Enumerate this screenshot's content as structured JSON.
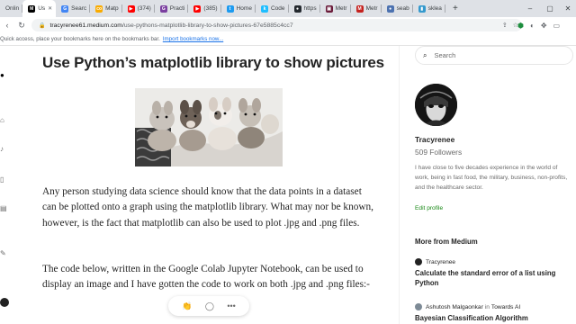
{
  "browser": {
    "tabs": [
      {
        "label": "Onlin",
        "color": "#ffffff",
        "glyph": "",
        "active": false
      },
      {
        "label": "Us",
        "color": "#000000",
        "glyph": "M",
        "active": true
      },
      {
        "label": "Searc",
        "color": "#4285f4",
        "glyph": "G",
        "active": false
      },
      {
        "label": "Matp",
        "color": "#f9ab00",
        "glyph": "co",
        "active": false
      },
      {
        "label": "(374)",
        "color": "#ff0000",
        "glyph": "▶",
        "active": false
      },
      {
        "label": "Practi",
        "color": "#7b3fa0",
        "glyph": "G",
        "active": false
      },
      {
        "label": "(385)",
        "color": "#ff0000",
        "glyph": "▶",
        "active": false
      },
      {
        "label": "Home",
        "color": "#1d9bf0",
        "glyph": "t",
        "active": false
      },
      {
        "label": "Code",
        "color": "#20beff",
        "glyph": "k",
        "active": false
      },
      {
        "label": "https",
        "color": "#24292f",
        "glyph": "●",
        "active": false
      },
      {
        "label": "Metr",
        "color": "#6a1b3a",
        "glyph": "▣",
        "active": false
      },
      {
        "label": "Metr",
        "color": "#c5221f",
        "glyph": "M",
        "active": false
      },
      {
        "label": "seab",
        "color": "#4c72b0",
        "glyph": "●",
        "active": false
      },
      {
        "label": "sklea",
        "color": "#3499cd",
        "glyph": "▮",
        "active": false
      }
    ],
    "address": {
      "host": "tracyrenee61.medium.com",
      "path": "/use-pythons-matplotlib-library-to-show-pictures-67e5885c4cc7"
    },
    "bookmarks_text": "Quick access, place your bookmarks here on the bookmarks bar.",
    "bookmarks_link": "Import bookmarks now..."
  },
  "article": {
    "title": "Use Python’s matplotlib library to show pictures",
    "paragraph1": "Any person studying data science should know that the data points in a dataset can be plotted onto a graph using the matplotlib library. What may nor be known, however, is the fact that matplotlib can also be used to plot .jpg and .png files.",
    "paragraph2": "The code below, written in the Google Colab Jupyter Notebook, can be used to display an image and I have gotten the code to work on both .jpg and .png files:-"
  },
  "sidebar": {
    "search_placeholder": "Search",
    "author_name": "Tracyrenee",
    "followers": "509 Followers",
    "bio": "I have close to five decades experience in the world of work, being in fast food, the military, business, non-profits, and the healthcare sector.",
    "edit_profile": "Edit profile",
    "more_heading": "More from Medium",
    "recommendations": [
      {
        "author": "Tracyrenee",
        "publication": "",
        "title": "Calculate the standard error of a list using Python"
      },
      {
        "author": "Ashutosh Malgaonkar",
        "in": "in",
        "publication": "Towards AI",
        "title": "Bayesian Classification Algorithm"
      }
    ]
  }
}
